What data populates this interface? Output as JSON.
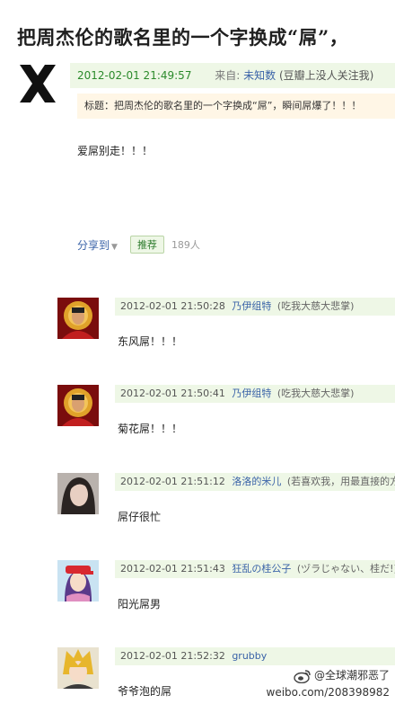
{
  "title": "把周杰伦的歌名里的一个字换成“屌”，",
  "post": {
    "time": "2012-02-01 21:49:57",
    "from_label": "来自:",
    "source_name": "未知数",
    "source_suffix": "(豆瓣上没人关注我)",
    "subject": "标题：把周杰伦的歌名里的一个字换成“屌”，瞬间屌爆了！！！",
    "body": "爱屌别走！！！",
    "share_label": "分享到",
    "recommend_label": "推荐",
    "recommend_count": "189人"
  },
  "comments": [
    {
      "time": "2012-02-01 21:50:28",
      "user": "乃伊组特",
      "note": "(吃我大慈大悲掌)",
      "text": "东风屌！！！"
    },
    {
      "time": "2012-02-01 21:50:41",
      "user": "乃伊组特",
      "note": "(吃我大慈大悲掌)",
      "text": "菊花屌！！！"
    },
    {
      "time": "2012-02-01 21:51:12",
      "user": "洛洛的米儿",
      "note": "(若喜欢我，用最直接的方",
      "text": "屌仔很忙"
    },
    {
      "time": "2012-02-01 21:51:43",
      "user": "狂乱の桂公子",
      "note": "(ヅラじゃない、桂だ!)",
      "text": "阳光屌男"
    },
    {
      "time": "2012-02-01 21:52:32",
      "user": "grubby",
      "note": "",
      "text": "爷爷泡的屌"
    }
  ],
  "watermark": {
    "handle": "@全球潮邪恶了",
    "url": "weibo.com/208398982"
  }
}
